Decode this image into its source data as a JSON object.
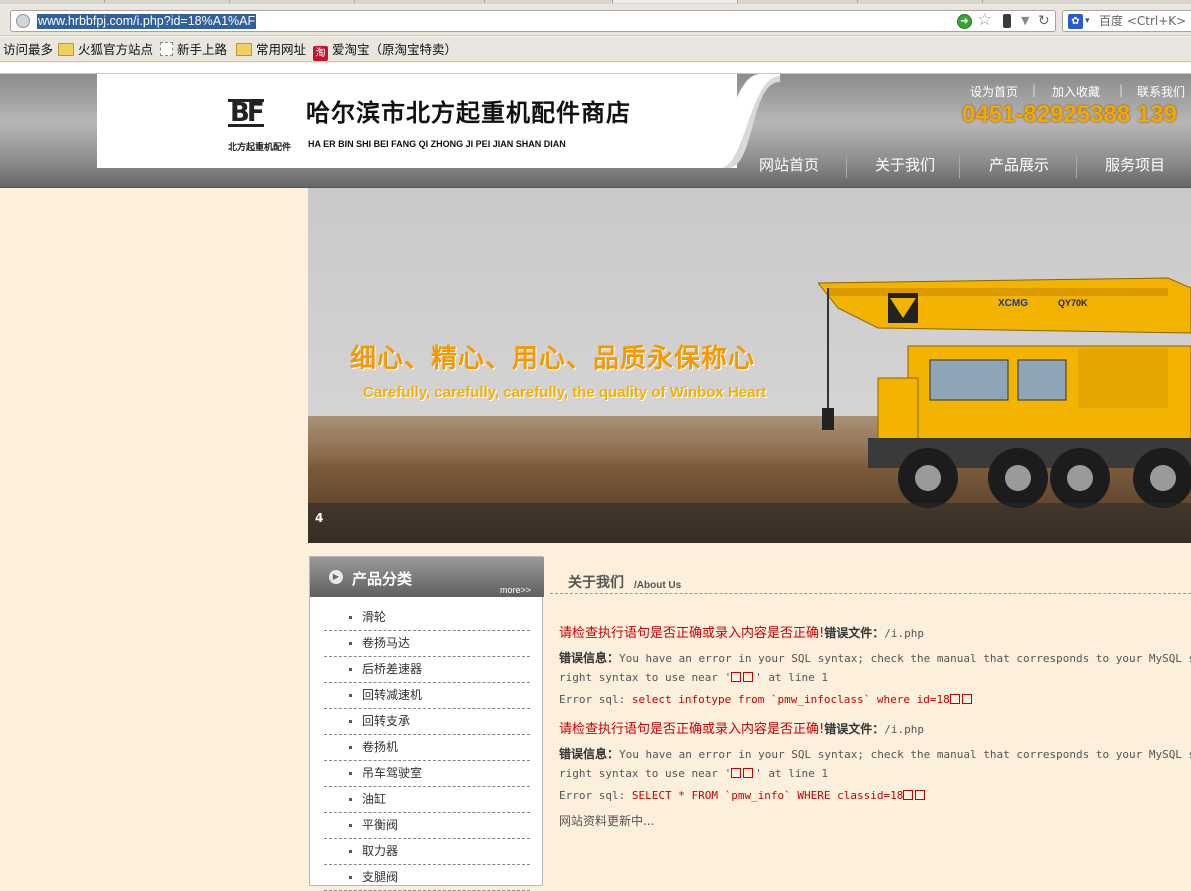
{
  "browser": {
    "url": "www.hrbbfpj.com/i.php?id=18%A1%AF",
    "search_placeholder": "百度 <Ctrl+K>",
    "bookmarks": [
      {
        "label": "访问最多",
        "icon": "none"
      },
      {
        "label": "火狐官方站点",
        "icon": "folder-icon"
      },
      {
        "label": "新手上路",
        "icon": "page-icon"
      },
      {
        "label": "常用网址",
        "icon": "folder-icon"
      },
      {
        "label": "爱淘宝（原淘宝特卖）",
        "icon": "taobao-icon"
      }
    ]
  },
  "header": {
    "logo_mark": "BF",
    "logo_sub": "北方起重机配件",
    "title": "哈尔滨市北方起重机配件商店",
    "title_en": "HA ER BIN SHI BEI FANG QI ZHONG JI PEI JIAN SHAN DIAN",
    "toplinks": [
      "设为首页",
      "加入收藏",
      "联系我们"
    ],
    "toplink_sep": "|",
    "phone": "0451-82925388  139",
    "nav": [
      "网站首页",
      "关于我们",
      "产品展示",
      "服务项目"
    ]
  },
  "banner": {
    "slogan": "细心、精心、用心、品质永保称心",
    "slogan_en": "Carefully, carefully, carefully, the quality of Winbox Heart",
    "slide_number": "4",
    "crane_label": "XCMG",
    "crane_model": "QY70K"
  },
  "sidebar": {
    "title": "产品分类",
    "more": "more>>",
    "items": [
      "滑轮",
      "卷扬马达",
      "后桥差速器",
      "回转减速机",
      "回转支承",
      "卷扬机",
      "吊车驾驶室",
      "油缸",
      "平衡阀",
      "取力器",
      "支腿阀"
    ]
  },
  "main": {
    "title": "关于我们",
    "subtitle": "/About Us",
    "errors": [
      {
        "heading": "请检查执行语句是否正确或录入内容是否正确!",
        "file_label": "错误文件：",
        "file": "/i.php",
        "info_label": "错误信息：",
        "info_text": "You have an error in your SQL syntax; check the manual that corresponds to your MySQL server ve",
        "info_text2a": "right syntax to use near '",
        "info_text2b": "' at line 1",
        "sql_label": "Error sql: ",
        "sql": "select infotype from `pmw_infoclass` where id=18"
      },
      {
        "heading": "请检查执行语句是否正确或录入内容是否正确!",
        "file_label": "错误文件：",
        "file": "/i.php",
        "info_label": "错误信息：",
        "info_text": "You have an error in your SQL syntax; check the manual that corresponds to your MySQL server ve",
        "info_text2a": "right syntax to use near '",
        "info_text2b": "' at line 1",
        "sql_label": "Error sql: ",
        "sql": "SELECT * FROM `pmw_info` WHERE classid=18"
      }
    ],
    "updating": "网站资料更新中..."
  }
}
